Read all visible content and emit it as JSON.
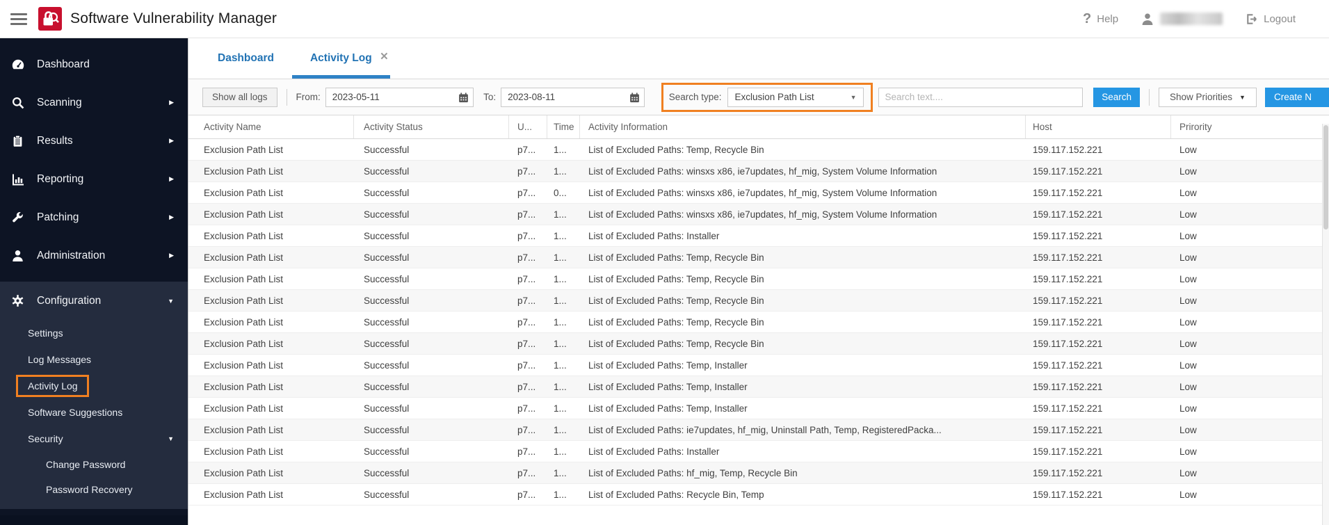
{
  "colors": {
    "accent_orange": "#f08021",
    "button_blue": "#2596e3",
    "tab_blue": "#2273b4",
    "tab_underline": "#2e82c6",
    "sidebar_bg": "#0d1424",
    "sidebar_section_bg": "#242c3e",
    "logo_red": "#c8102e"
  },
  "icons": {
    "help": "?",
    "close": "✕",
    "caret_down": "▼",
    "arrow_right": "▶"
  },
  "topbar": {
    "app_title": "Software Vulnerability Manager",
    "help_label": "Help",
    "logout_label": "Logout"
  },
  "sidebar": {
    "items": [
      {
        "label": "Dashboard",
        "icon": "gauge-icon"
      },
      {
        "label": "Scanning",
        "icon": "magnifier-icon"
      },
      {
        "label": "Results",
        "icon": "clipboard-icon"
      },
      {
        "label": "Reporting",
        "icon": "bar-chart-icon"
      },
      {
        "label": "Patching",
        "icon": "wrench-icon"
      },
      {
        "label": "Administration",
        "icon": "person-icon"
      }
    ],
    "config": {
      "label": "Configuration",
      "items": [
        "Settings",
        "Log Messages",
        "Activity Log",
        "Software Suggestions"
      ],
      "selected": "Activity Log",
      "security": {
        "label": "Security",
        "items": [
          "Change Password",
          "Password Recovery"
        ]
      }
    }
  },
  "tabs": {
    "dashboard": "Dashboard",
    "activity_log": "Activity Log"
  },
  "toolbar": {
    "show_all_logs": "Show all logs",
    "from_label": "From:",
    "from_value": "2023-05-11",
    "to_label": "To:",
    "to_value": "2023-08-11",
    "search_type_label": "Search type:",
    "search_type_value": "Exclusion Path List",
    "search_placeholder": "Search text....",
    "search_button": "Search",
    "show_priorities": "Show Priorities",
    "create_button": "Create N"
  },
  "grid": {
    "fields": [
      "name",
      "status",
      "user",
      "time",
      "info",
      "host",
      "priority"
    ],
    "headers": {
      "name": "Activity Name",
      "status": "Activity Status",
      "user": "U...",
      "time": "Time",
      "info": "Activity Information",
      "host": "Host",
      "priority": "Prirority"
    },
    "rows": [
      {
        "name": "Exclusion Path List",
        "status": "Successful",
        "user": "p7...",
        "time": "1...",
        "info": "List of Excluded Paths: Temp, Recycle Bin",
        "host": "159.117.152.221",
        "priority": "Low"
      },
      {
        "name": "Exclusion Path List",
        "status": "Successful",
        "user": "p7...",
        "time": "1...",
        "info": "List of Excluded Paths: winsxs x86, ie7updates, hf_mig, System Volume Information",
        "host": "159.117.152.221",
        "priority": "Low"
      },
      {
        "name": "Exclusion Path List",
        "status": "Successful",
        "user": "p7...",
        "time": "0...",
        "info": "List of Excluded Paths: winsxs x86, ie7updates, hf_mig, System Volume Information",
        "host": "159.117.152.221",
        "priority": "Low"
      },
      {
        "name": "Exclusion Path List",
        "status": "Successful",
        "user": "p7...",
        "time": "1...",
        "info": "List of Excluded Paths: winsxs x86, ie7updates, hf_mig, System Volume Information",
        "host": "159.117.152.221",
        "priority": "Low"
      },
      {
        "name": "Exclusion Path List",
        "status": "Successful",
        "user": "p7...",
        "time": "1...",
        "info": "List of Excluded Paths: Installer",
        "host": "159.117.152.221",
        "priority": "Low"
      },
      {
        "name": "Exclusion Path List",
        "status": "Successful",
        "user": "p7...",
        "time": "1...",
        "info": "List of Excluded Paths: Temp, Recycle Bin",
        "host": "159.117.152.221",
        "priority": "Low"
      },
      {
        "name": "Exclusion Path List",
        "status": "Successful",
        "user": "p7...",
        "time": "1...",
        "info": "List of Excluded Paths: Temp, Recycle Bin",
        "host": "159.117.152.221",
        "priority": "Low"
      },
      {
        "name": "Exclusion Path List",
        "status": "Successful",
        "user": "p7...",
        "time": "1...",
        "info": "List of Excluded Paths: Temp, Recycle Bin",
        "host": "159.117.152.221",
        "priority": "Low"
      },
      {
        "name": "Exclusion Path List",
        "status": "Successful",
        "user": "p7...",
        "time": "1...",
        "info": "List of Excluded Paths: Temp, Recycle Bin",
        "host": "159.117.152.221",
        "priority": "Low"
      },
      {
        "name": "Exclusion Path List",
        "status": "Successful",
        "user": "p7...",
        "time": "1...",
        "info": "List of Excluded Paths: Temp, Recycle Bin",
        "host": "159.117.152.221",
        "priority": "Low"
      },
      {
        "name": "Exclusion Path List",
        "status": "Successful",
        "user": "p7...",
        "time": "1...",
        "info": "List of Excluded Paths: Temp, Installer",
        "host": "159.117.152.221",
        "priority": "Low"
      },
      {
        "name": "Exclusion Path List",
        "status": "Successful",
        "user": "p7...",
        "time": "1...",
        "info": "List of Excluded Paths: Temp, Installer",
        "host": "159.117.152.221",
        "priority": "Low"
      },
      {
        "name": "Exclusion Path List",
        "status": "Successful",
        "user": "p7...",
        "time": "1...",
        "info": "List of Excluded Paths: Temp, Installer",
        "host": "159.117.152.221",
        "priority": "Low"
      },
      {
        "name": "Exclusion Path List",
        "status": "Successful",
        "user": "p7...",
        "time": "1...",
        "info": "List of Excluded Paths: ie7updates, hf_mig, Uninstall Path, Temp, RegisteredPacka...",
        "host": "159.117.152.221",
        "priority": "Low"
      },
      {
        "name": "Exclusion Path List",
        "status": "Successful",
        "user": "p7...",
        "time": "1...",
        "info": "List of Excluded Paths: Installer",
        "host": "159.117.152.221",
        "priority": "Low"
      },
      {
        "name": "Exclusion Path List",
        "status": "Successful",
        "user": "p7...",
        "time": "1...",
        "info": "List of Excluded Paths: hf_mig, Temp, Recycle Bin",
        "host": "159.117.152.221",
        "priority": "Low"
      },
      {
        "name": "Exclusion Path List",
        "status": "Successful",
        "user": "p7...",
        "time": "1...",
        "info": "List of Excluded Paths: Recycle Bin, Temp",
        "host": "159.117.152.221",
        "priority": "Low"
      }
    ]
  }
}
